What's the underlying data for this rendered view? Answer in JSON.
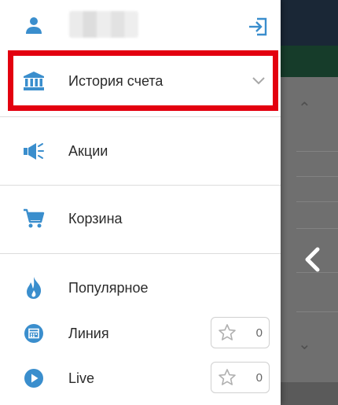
{
  "header": {
    "user_name": "",
    "logout_icon": "logout-icon"
  },
  "menu": {
    "account_history": "История счета",
    "promotions": "Акции",
    "cart": "Корзина",
    "popular": "Популярное",
    "line": "Линия",
    "live": "Live"
  },
  "favorites": {
    "line_count": "0",
    "live_count": "0"
  },
  "colors": {
    "accent": "#3a8ecd",
    "highlight": "#e3000f",
    "text": "#2b2b2b"
  },
  "icons": {
    "user": "user-icon",
    "bank": "bank-icon",
    "megaphone": "megaphone-icon",
    "cart": "cart-icon",
    "flame": "flame-icon",
    "calendar": "calendar-icon",
    "play": "play-icon",
    "star": "star-icon",
    "chevron": "chevron-down-icon",
    "back": "chevron-left-icon"
  }
}
